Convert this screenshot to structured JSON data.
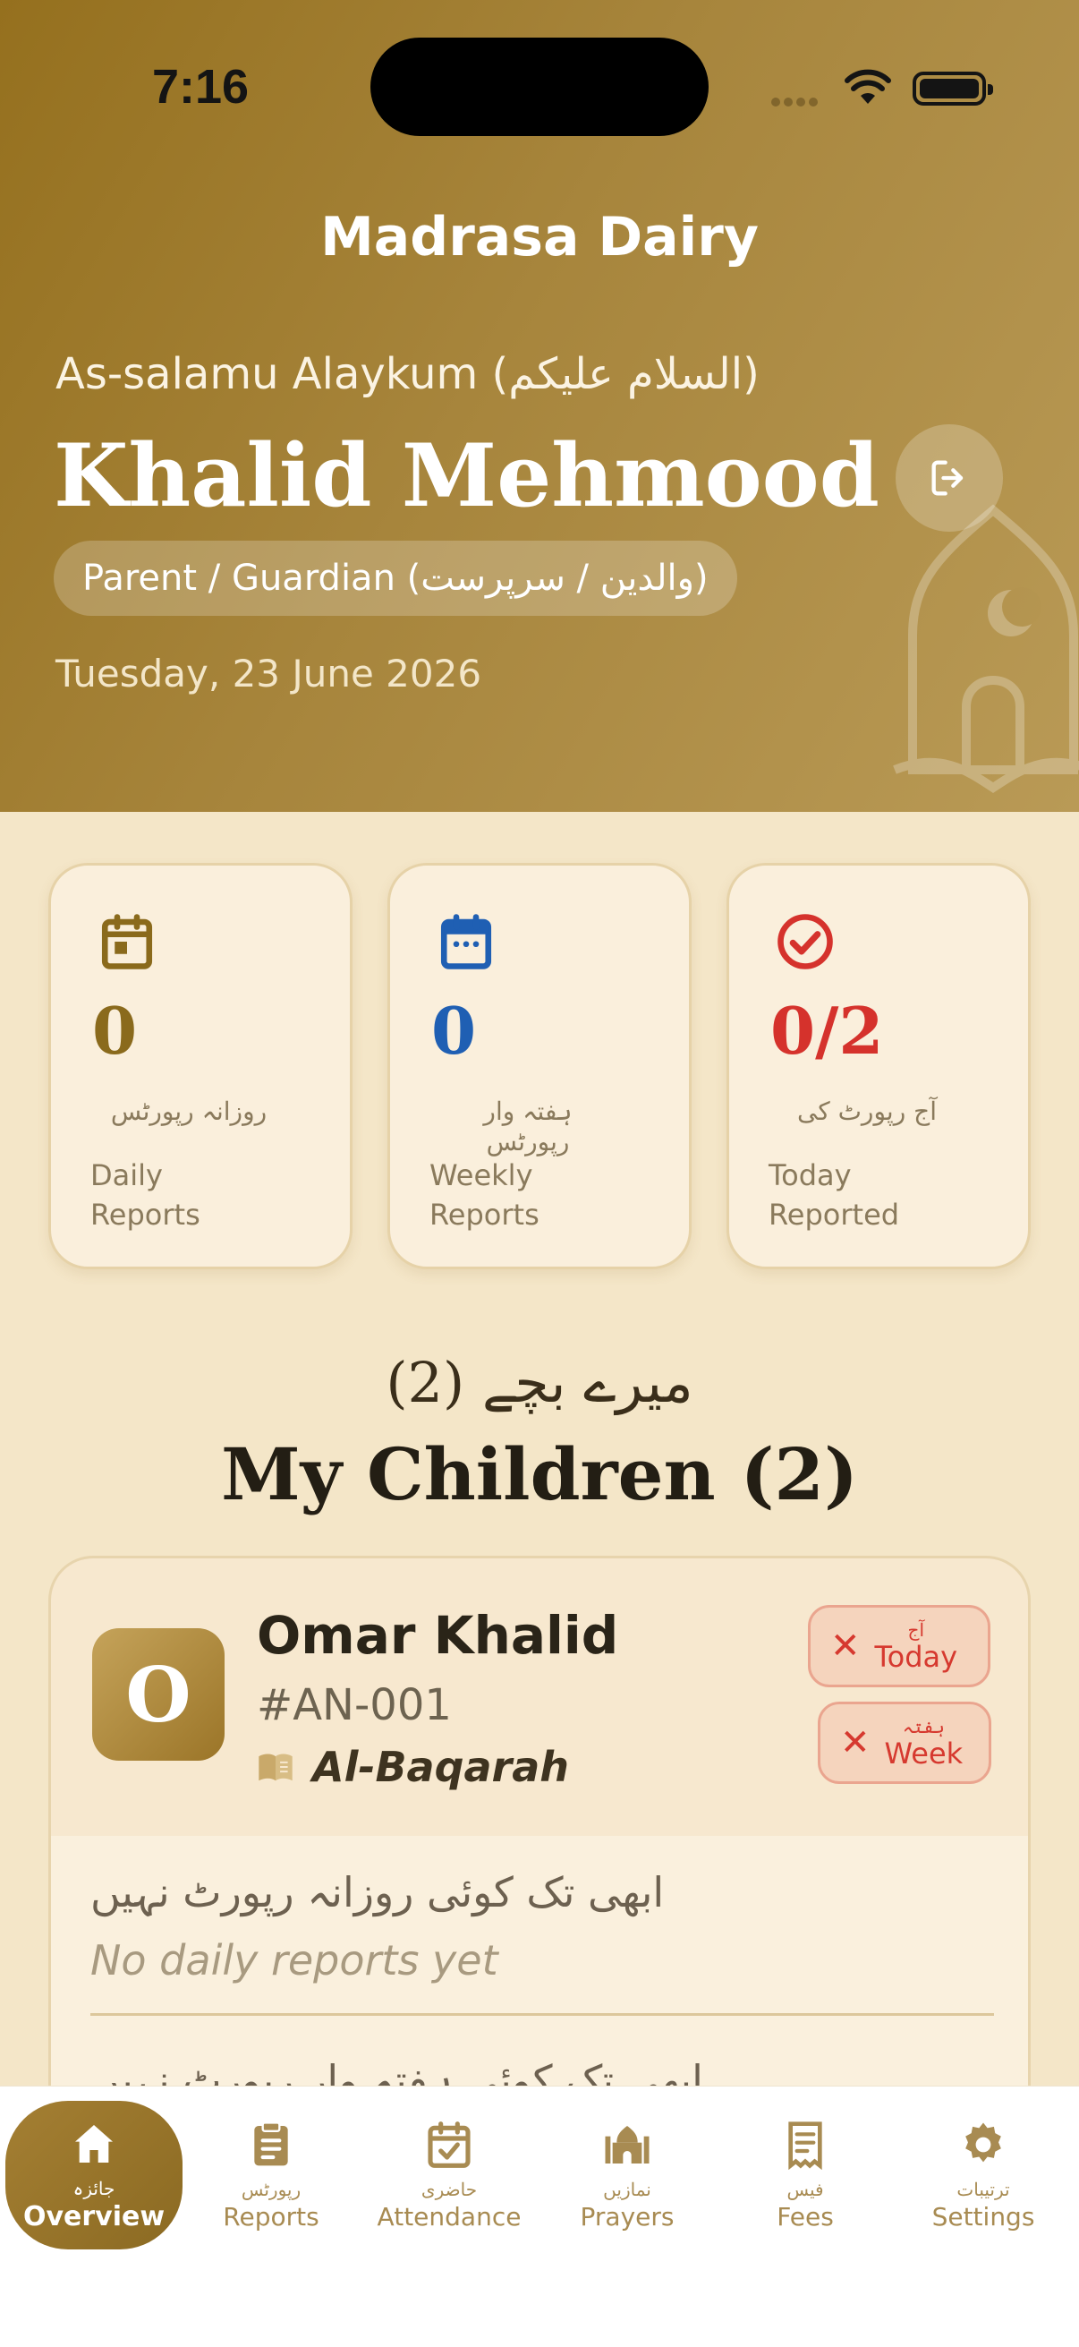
{
  "status_bar": {
    "time": "7:16"
  },
  "header": {
    "app_title": "Madrasa Dairy",
    "greeting": "As-salamu Alaykum (السلام علیکم)",
    "user_name": "Khalid Mehmood",
    "role": "Parent / Guardian (والدین / سرپرست)",
    "date": "Tuesday, 23 June 2026"
  },
  "stats": [
    {
      "value": "0",
      "urdu": "روزانہ رپورٹس",
      "label": "Daily Reports",
      "color": "#8a6a1c",
      "icon": "calendar-day-icon"
    },
    {
      "value": "0",
      "urdu": "ہفتہ وار رپورٹس",
      "label": "Weekly Reports",
      "color": "#1f5fb3",
      "icon": "calendar-week-icon"
    },
    {
      "value": "0/2",
      "urdu": "آج رپورٹ کی",
      "label": "Today Reported",
      "color": "#d5322c",
      "icon": "check-circle-icon"
    }
  ],
  "children_section": {
    "urdu_title": "میرے بچے (2)",
    "title": "My Children (2)"
  },
  "children": [
    {
      "initial": "O",
      "name": "Omar Khalid",
      "id": "#AN-001",
      "current_lesson": "Al-Baqarah",
      "today_status": {
        "urdu": "آج",
        "label": "Today"
      },
      "week_status": {
        "urdu": "ہفتہ",
        "label": "Week"
      },
      "no_daily_urdu": "ابھی تک کوئی روزانہ رپورٹ نہیں",
      "no_daily": "No daily reports yet",
      "no_weekly_urdu": "ابھی تک کوئی ہفتہ وار رپورٹ نہیں"
    }
  ],
  "tabs": [
    {
      "urdu": "جائزہ",
      "label": "Overview",
      "icon": "home-icon",
      "active": true
    },
    {
      "urdu": "رپورٹس",
      "label": "Reports",
      "icon": "clipboard-icon",
      "active": false
    },
    {
      "urdu": "حاضری",
      "label": "Attendance",
      "icon": "calendar-check-icon",
      "active": false
    },
    {
      "urdu": "نمازیں",
      "label": "Prayers",
      "icon": "mosque-icon",
      "active": false
    },
    {
      "urdu": "فیس",
      "label": "Fees",
      "icon": "receipt-icon",
      "active": false
    },
    {
      "urdu": "ترتیبات",
      "label": "Settings",
      "icon": "gear-icon",
      "active": false
    }
  ]
}
